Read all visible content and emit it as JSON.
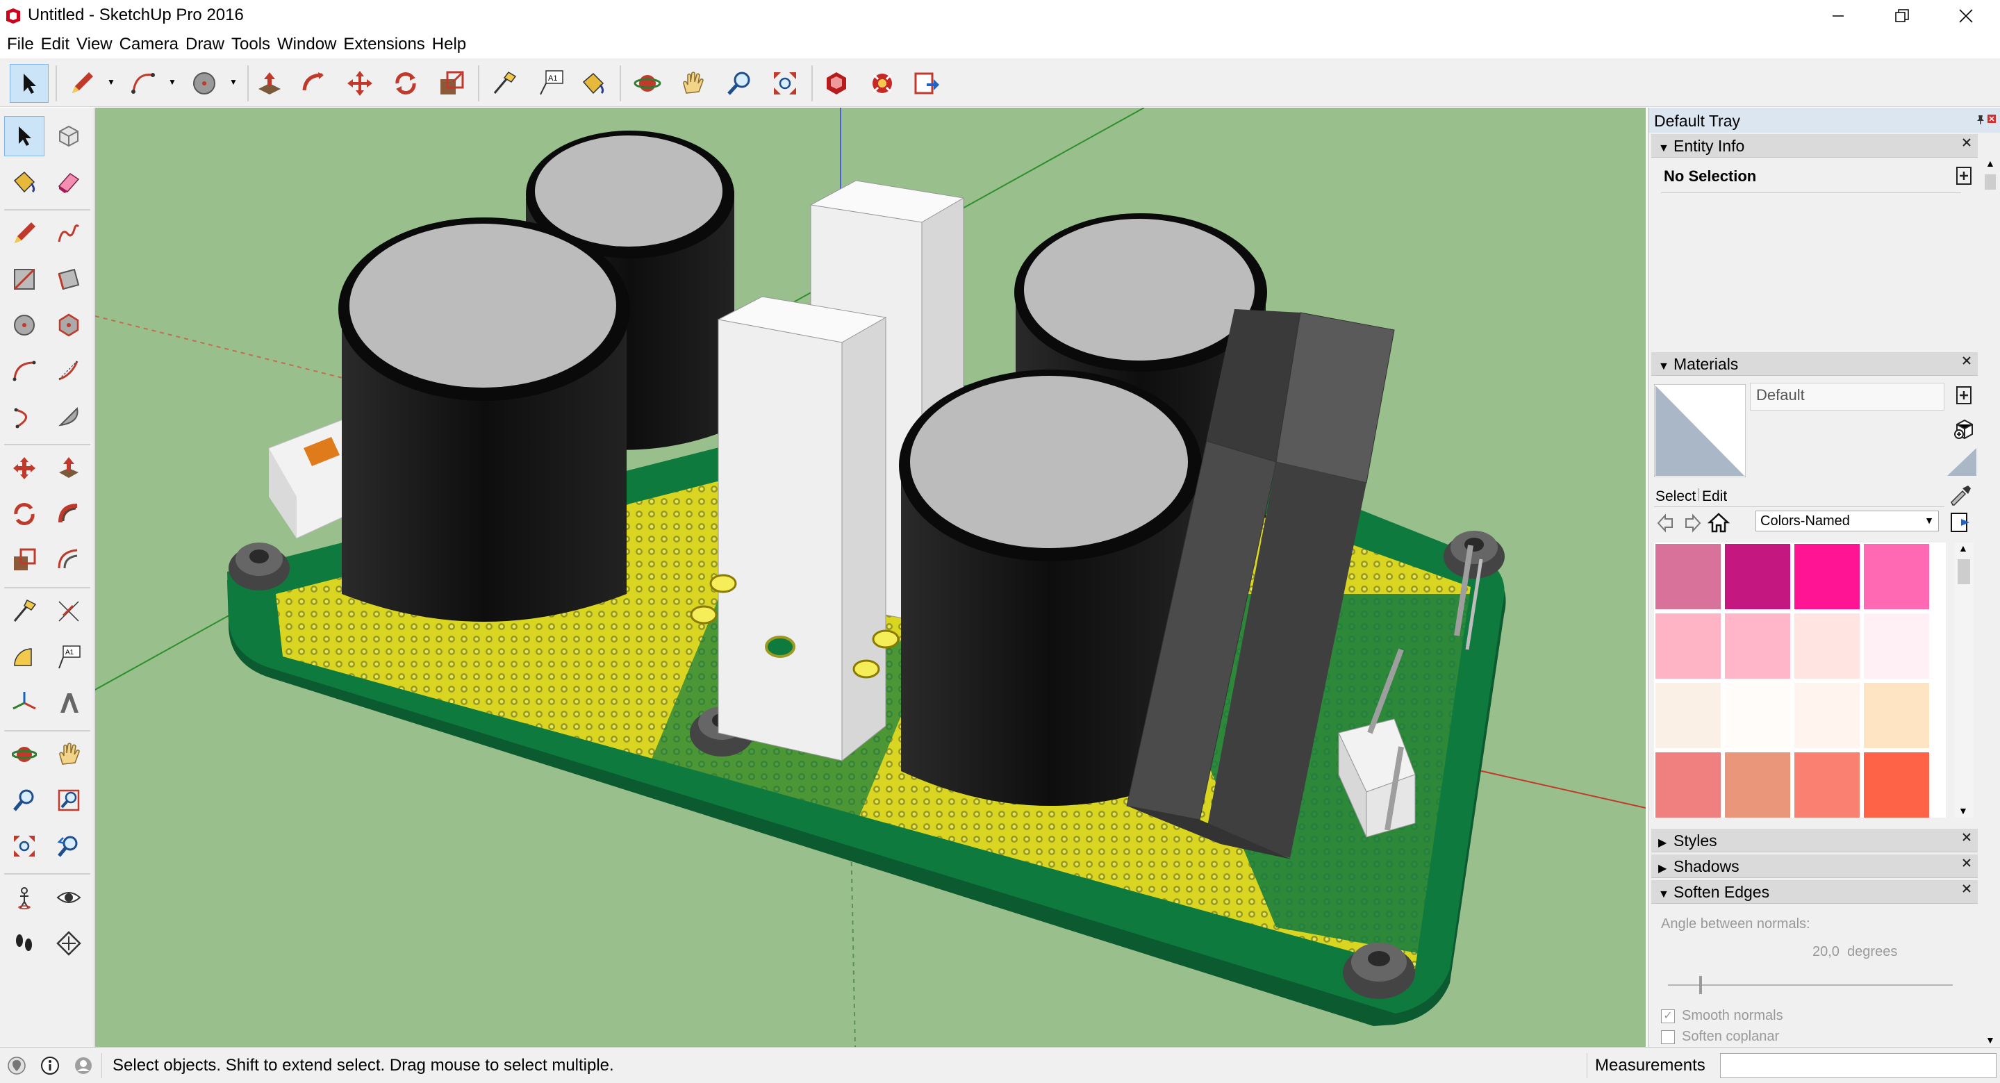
{
  "window": {
    "title": "Untitled - SketchUp Pro 2016",
    "minimize": "—",
    "restore": "❐",
    "close": "✕"
  },
  "menu": [
    "File",
    "Edit",
    "View",
    "Camera",
    "Draw",
    "Tools",
    "Window",
    "Extensions",
    "Help"
  ],
  "tray": {
    "title": "Default Tray",
    "entity_info": {
      "header": "Entity Info",
      "selection": "No Selection"
    },
    "materials": {
      "header": "Materials",
      "material_name": "Default",
      "tab_select": "Select",
      "tab_edit": "Edit",
      "library": "Colors-Named",
      "swatches": [
        "#d8729b",
        "#c4177f",
        "#ff1493",
        "#ff69b4",
        "#ffb4c5",
        "#ffb6c8",
        "#ffe4e1",
        "#fff0f5",
        "#faf0e6",
        "#fffcf9",
        "#fff5ee",
        "#ffe4c4",
        "#f08080",
        "#e9967a",
        "#fa8072",
        "#ff6347"
      ]
    },
    "styles": {
      "header": "Styles"
    },
    "shadows": {
      "header": "Shadows"
    },
    "soften_edges": {
      "header": "Soften Edges",
      "angle_label": "Angle between normals:",
      "angle_value": "20,0  degrees",
      "slider_level": 0.11,
      "smooth_normals": "Smooth normals",
      "soften_coplanar": "Soften coplanar",
      "smooth_checked": true,
      "coplanar_checked": false
    }
  },
  "status": {
    "hint": "Select objects. Shift to extend select. Drag mouse to select multiple.",
    "measurements_label": "Measurements",
    "measurements_value": ""
  },
  "colors": {
    "viewport_bg": "#98bf8c",
    "pcb": "#0e6b3a",
    "pcb_dots": "#e8e11a",
    "capacitor": "#111111",
    "capacitor_top": "#bdbdbd",
    "resistor": "#f4f4f4",
    "transformer": "#4f4f4f",
    "accent": "#cce4f7"
  }
}
